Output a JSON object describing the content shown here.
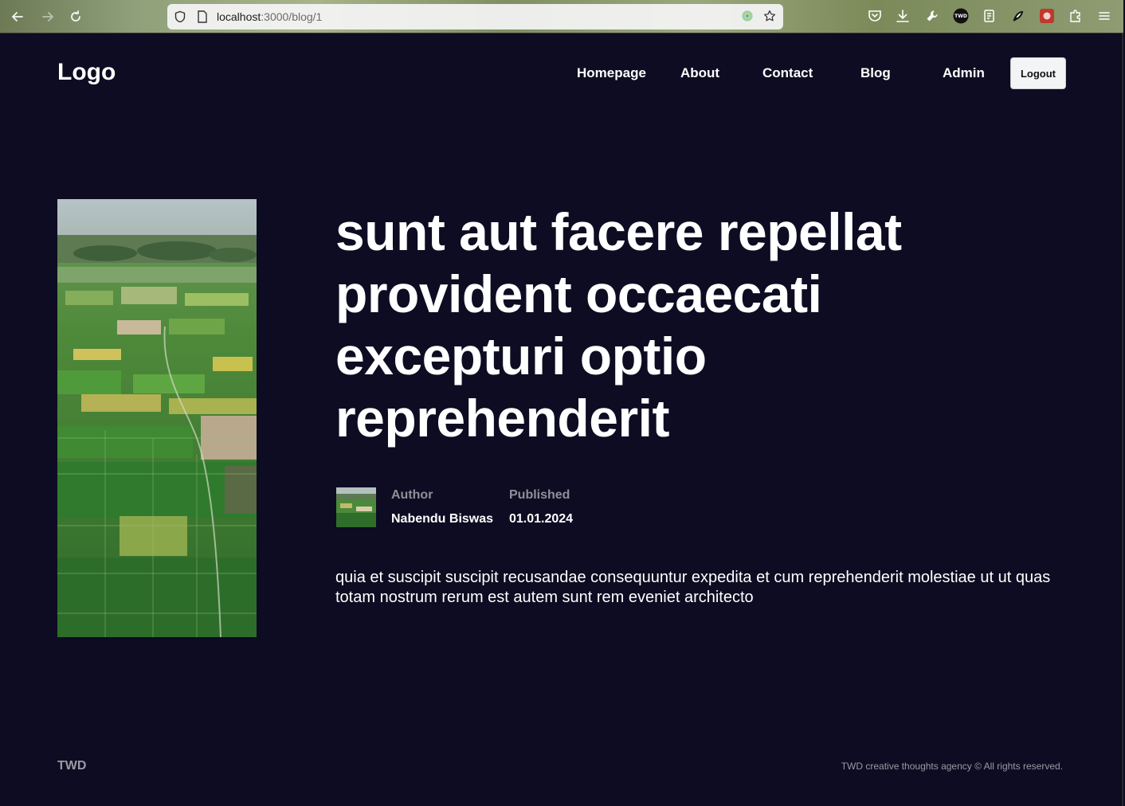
{
  "browser": {
    "url_host": "localhost",
    "url_path": ":3000/blog/1",
    "icons": [
      "back-icon",
      "forward-icon",
      "reload-icon",
      "shield-icon",
      "page-icon",
      "extension-badge-icon",
      "bookmark-star-icon",
      "pocket-icon",
      "download-icon",
      "wrench-icon",
      "twd-extension-icon",
      "reader-icon",
      "extension-icon",
      "extension-red-icon",
      "puzzle-icon",
      "menu-icon"
    ],
    "twd_badge": "TWD"
  },
  "nav": {
    "logo": "Logo",
    "links": [
      "Homepage",
      "About",
      "Contact",
      "Blog",
      "Admin"
    ],
    "logout": "Logout"
  },
  "post": {
    "title": "sunt aut facere repellat provident occaecati excepturi optio reprehenderit",
    "author_label": "Author",
    "author_name": "Nabendu Biswas",
    "published_label": "Published",
    "published_date": "01.01.2024",
    "body": "quia et suscipit suscipit recusandae consequuntur expedita et cum reprehenderit molestiae ut ut quas totam nostrum rerum est autem sunt rem eveniet architecto"
  },
  "footer": {
    "brand": "TWD",
    "copyright": "TWD creative thoughts agency © All rights reserved."
  },
  "colors": {
    "background": "#0d0c22",
    "text": "#ffffff",
    "muted": "#9a9aa3"
  }
}
